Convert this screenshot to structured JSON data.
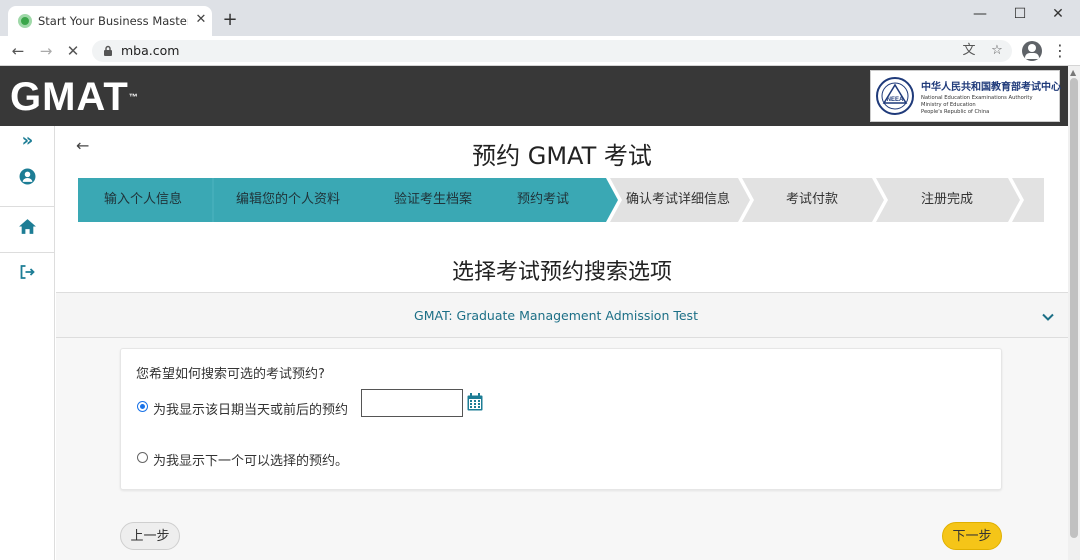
{
  "browser": {
    "tab_title": "Start Your Business Master's a",
    "tab_close": "✕",
    "new_tab": "+",
    "url": "mba.com",
    "window_controls": {
      "minimize": "—",
      "maximize": "☐",
      "close": "✕"
    },
    "nav": {
      "back": "←",
      "forward": "→",
      "stop": "✕"
    },
    "omnibox_icons": {
      "translate": "文",
      "bookmark": "☆"
    },
    "menu": "⋮"
  },
  "site": {
    "logo_text": "GMAT",
    "logo_mark": "™",
    "partner": {
      "name_cn": "中华人民共和国教育部考试中心",
      "name_en_lines": [
        "National Education Examinations Authority",
        "Ministry of Education",
        "People's Republic of China"
      ],
      "seal_text": "NEEA"
    }
  },
  "sidebar": {
    "items": [
      {
        "icon": "chevron-double-right-icon",
        "glyph": "»"
      },
      {
        "icon": "user-circle-icon"
      },
      {
        "icon": "home-icon"
      },
      {
        "icon": "sign-out-icon"
      }
    ]
  },
  "main": {
    "back_glyph": "←",
    "page_title": "预约 GMAT 考试",
    "steps": [
      {
        "label": "输入个人信息",
        "status": "done"
      },
      {
        "label": "编辑您的个人资料",
        "status": "done"
      },
      {
        "label": "验证考生档案",
        "status": "done"
      },
      {
        "label": "预约考试",
        "status": "current"
      },
      {
        "label": "确认考试详细信息",
        "status": "todo"
      },
      {
        "label": "考试付款",
        "status": "todo"
      },
      {
        "label": "注册完成",
        "status": "todo"
      }
    ],
    "section_title": "选择考试预约搜索选项",
    "accordion_label": "GMAT: Graduate Management Admission Test",
    "question": "您希望如何搜索可选的考试预约?",
    "options": [
      {
        "label": "为我显示该日期当天或前后的预约",
        "checked": true
      },
      {
        "label": "为我显示下一个可以选择的预约。",
        "checked": false
      }
    ],
    "date_value": "",
    "prev_button": "上一步",
    "next_button": "下一步"
  },
  "colors": {
    "teal_done": "#3aa8b4",
    "grey_todo": "#e2e2e2",
    "header_bg": "#383838",
    "accent_link": "#1c6f86",
    "next_button": "#f5c518"
  }
}
